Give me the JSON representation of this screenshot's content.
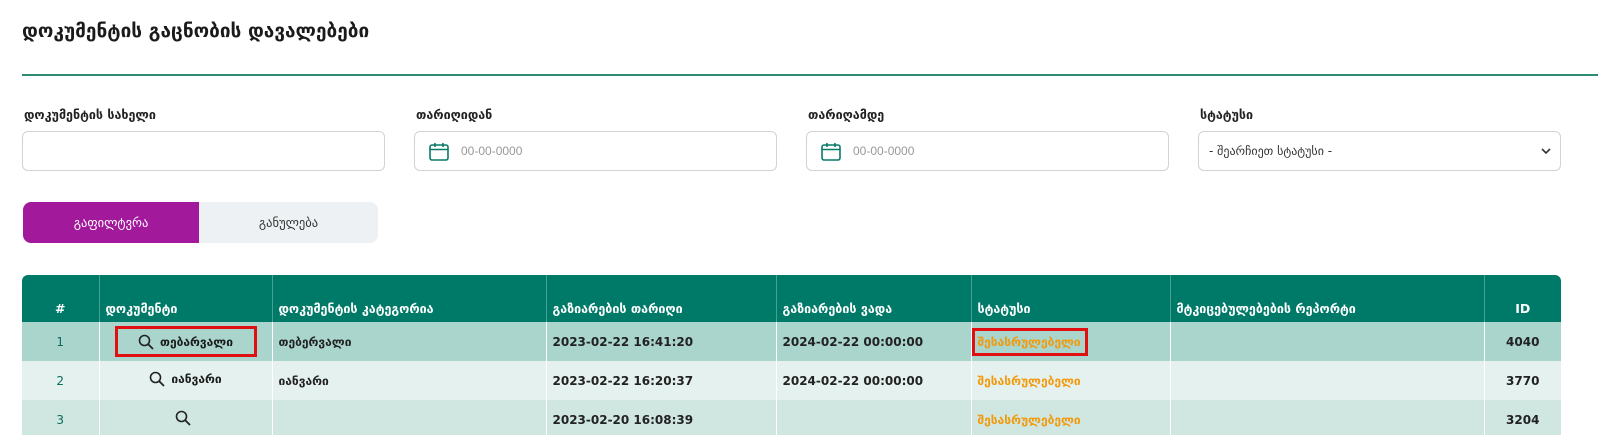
{
  "page": {
    "title": "დოკუმენტის გაცნობის დავალებები"
  },
  "filters": {
    "doc_name": {
      "label": "დოკუმენტის სახელი",
      "value": "",
      "placeholder": ""
    },
    "date_from": {
      "label": "თარიღიდან",
      "placeholder": "00-00-0000"
    },
    "date_to": {
      "label": "თარიღამდე",
      "placeholder": "00-00-0000"
    },
    "status": {
      "label": "სტატუსი",
      "selected": "- შეარჩიეთ სტატუსი -"
    }
  },
  "buttons": {
    "filter": "გაფილტვრა",
    "reset": "განულება"
  },
  "table": {
    "headers": [
      "#",
      "დოკუმენტი",
      "დოკუმენტის კატეგორია",
      "გაზიარების თარიღი",
      "გაზიარების ვადა",
      "სტატუსი",
      "მტკიცებულებების რეპორტი",
      "ID"
    ],
    "rows": [
      {
        "num": "1",
        "document": "თებარვალი",
        "category": "თებერვალი",
        "shared_date": "2023-02-22 16:41:20",
        "deadline": "2024-02-22 00:00:00",
        "status": "შესასრულებელი",
        "report": "",
        "id": "4040"
      },
      {
        "num": "2",
        "document": "იანვარი",
        "category": "იანვარი",
        "shared_date": "2023-02-22 16:20:37",
        "deadline": "2024-02-22 00:00:00",
        "status": "შესასრულებელი",
        "report": "",
        "id": "3770"
      },
      {
        "num": "3",
        "document": "",
        "category": "",
        "shared_date": "2023-02-20 16:08:39",
        "deadline": "",
        "status": "შესასრულებელი",
        "report": "",
        "id": "3204"
      }
    ]
  },
  "icons": {
    "calendar": "calendar-icon",
    "search": "search-icon",
    "chevron": "chevron-down-icon"
  },
  "colors": {
    "accent": "#007a68",
    "filter_button": "#a3199c",
    "status_pending": "#f29a0c",
    "highlight": "#e01010"
  }
}
